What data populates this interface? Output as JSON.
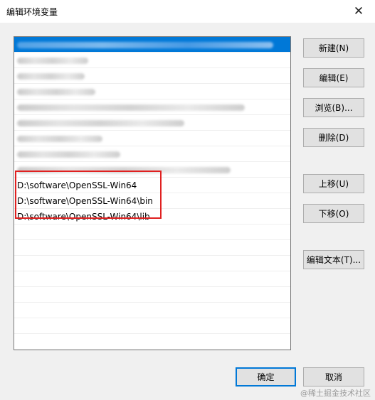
{
  "window": {
    "title": "编辑环境变量",
    "close_glyph": "✕"
  },
  "path_list": {
    "items": [
      {
        "text": "",
        "redacted": true,
        "selected": true
      },
      {
        "text": "",
        "redacted": true
      },
      {
        "text": "",
        "redacted": true
      },
      {
        "text": "",
        "redacted": true
      },
      {
        "text": "",
        "redacted": true
      },
      {
        "text": "",
        "redacted": true
      },
      {
        "text": "",
        "redacted": true
      },
      {
        "text": "",
        "redacted": true
      },
      {
        "text": "",
        "redacted": true
      },
      {
        "text": "D:\\software\\OpenSSL-Win64",
        "highlighted": true
      },
      {
        "text": "D:\\software\\OpenSSL-Win64\\bin",
        "highlighted": true
      },
      {
        "text": "D:\\software\\OpenSSL-Win64\\lib",
        "highlighted": true
      },
      {
        "text": ""
      },
      {
        "text": ""
      },
      {
        "text": ""
      },
      {
        "text": ""
      },
      {
        "text": ""
      },
      {
        "text": ""
      },
      {
        "text": ""
      },
      {
        "text": ""
      }
    ]
  },
  "buttons": {
    "new": "新建(N)",
    "edit": "编辑(E)",
    "browse": "浏览(B)...",
    "delete": "删除(D)",
    "move_up": "上移(U)",
    "move_down": "下移(O)",
    "edit_text": "编辑文本(T)...",
    "ok": "确定",
    "cancel": "取消"
  },
  "watermark": "@稀土掘金技术社区",
  "colors": {
    "selection": "#0078d7",
    "highlight_border": "#e02020"
  }
}
